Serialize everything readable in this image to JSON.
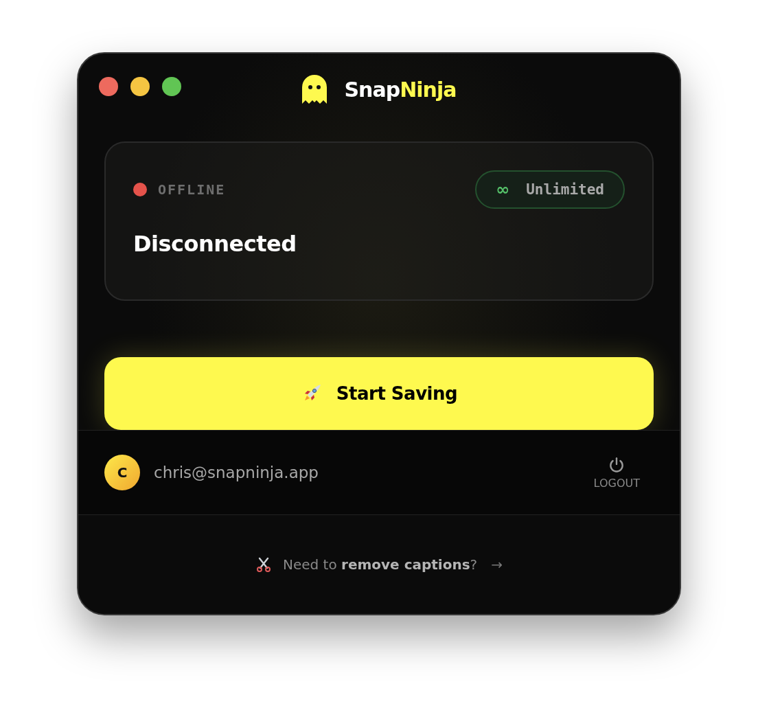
{
  "window": {
    "title_parts": [
      "Snap",
      "Ninja"
    ]
  },
  "status_card": {
    "status": {
      "label": "OFFLINE",
      "color": "#e5534b"
    },
    "plan_badge": {
      "icon": "∞",
      "label": "Unlimited"
    },
    "heading": "Disconnected"
  },
  "start_button": {
    "label": "Start Saving"
  },
  "account": {
    "avatar_initial": "C",
    "email": "chris@snapninja.app",
    "logout_label": "LOGOUT"
  },
  "promo": {
    "text": "Need to **remove captions**?",
    "arrow": "→"
  }
}
